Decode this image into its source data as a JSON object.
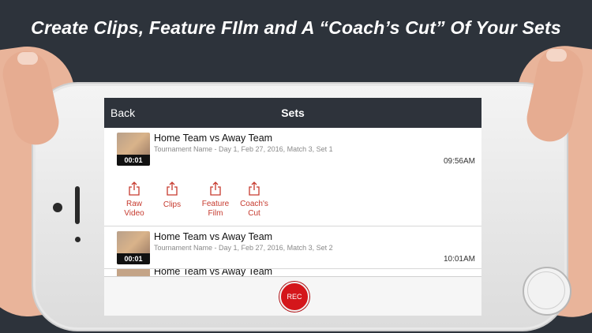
{
  "headline": "Create Clips, Feature FIlm and A “Coach’s Cut” Of Your Sets",
  "navbar": {
    "back_label": "Back",
    "title": "Sets"
  },
  "sets": [
    {
      "title": "Home Team vs Away Team",
      "subtitle": "Tournament Name - Day 1, Feb 27, 2016, Match 3, Set 1",
      "duration": "00:01",
      "time": "09:56AM"
    },
    {
      "title": "Home Team vs Away Team",
      "subtitle": "Tournament Name - Day 1, Feb 27, 2016, Match 3, Set 2",
      "duration": "00:01",
      "time": "10:01AM"
    },
    {
      "title": "Home Team vs Away Team"
    }
  ],
  "actions": [
    {
      "line1": "Raw",
      "line2": "Video",
      "icon": "share-icon"
    },
    {
      "line1": "Clips",
      "line2": "",
      "icon": "share-icon"
    },
    {
      "line1": "Feature",
      "line2": "Film",
      "icon": "share-icon"
    },
    {
      "line1": "Coach's",
      "line2": "Cut",
      "icon": "share-icon"
    }
  ],
  "footer": {
    "rec_label": "REC"
  },
  "colors": {
    "accent": "#c63a2e",
    "navbar": "#2e333b",
    "rec": "#d4161b",
    "background": "#2d333b"
  }
}
